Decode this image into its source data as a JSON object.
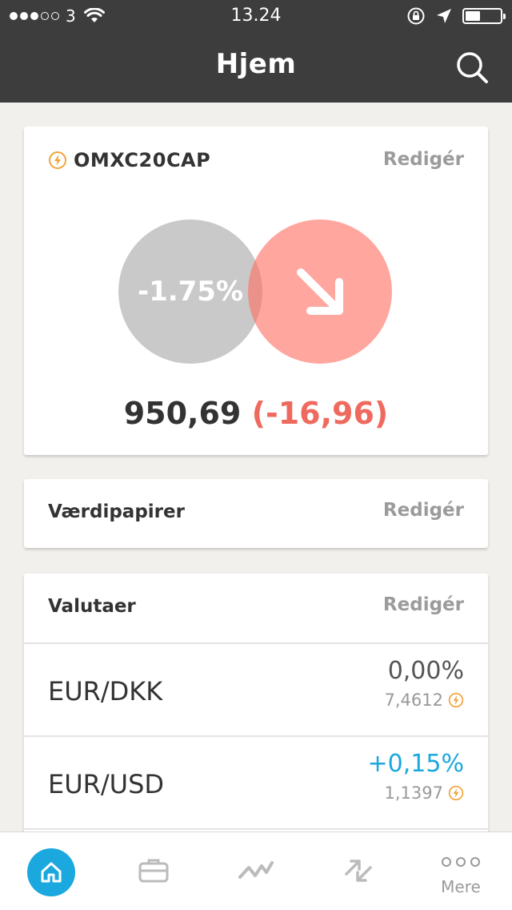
{
  "status_bar": {
    "carrier": "3",
    "time": "13.24",
    "signal_bars_filled": 3,
    "signal_bars_total": 5,
    "battery_level": 0.4
  },
  "nav": {
    "title": "Hjem",
    "search_icon": "search-icon"
  },
  "index_card": {
    "icon": "lightning-icon",
    "name": "OMXC20CAP",
    "edit_label": "Redigér",
    "change_pct": "-1.75%",
    "trend_icon": "arrow-down-right-icon",
    "value": "950,69",
    "change": "(-16,96)"
  },
  "securities_card": {
    "title": "Værdipapirer",
    "edit_label": "Redigér"
  },
  "currency_card": {
    "title": "Valutaer",
    "edit_label": "Redigér",
    "rows": [
      {
        "pair": "EUR/DKK",
        "change": "0,00%",
        "rate": "7,4612",
        "trend": "neutral"
      },
      {
        "pair": "EUR/USD",
        "change": "+0,15%",
        "rate": "1,1397",
        "trend": "up"
      }
    ]
  },
  "tab_bar": {
    "items": [
      {
        "icon": "home-icon",
        "active": true
      },
      {
        "icon": "briefcase-icon"
      },
      {
        "icon": "chart-line-icon"
      },
      {
        "icon": "transfer-arrows-icon"
      },
      {
        "icon": "more-dots-icon",
        "label": "Mere"
      }
    ]
  },
  "colors": {
    "accent": "#1aa8de",
    "negative": "#ef6a5e",
    "lightning": "#f2a33a",
    "header": "#3d3d3d"
  }
}
